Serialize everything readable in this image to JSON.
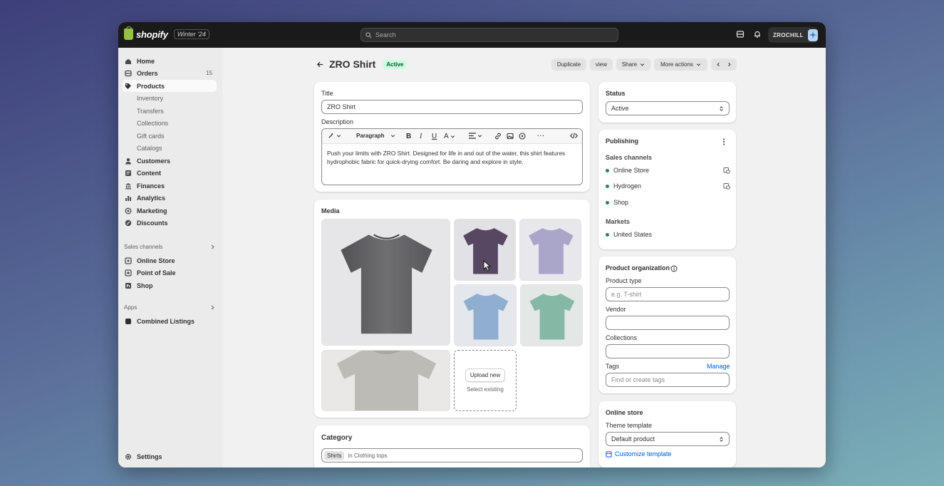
{
  "topbar": {
    "logo_text": "shopify",
    "edition": "Winter '24",
    "search_placeholder": "Search",
    "store_name": "ZROCHILL"
  },
  "sidebar": {
    "items": [
      {
        "label": "Home"
      },
      {
        "label": "Orders",
        "count": "15"
      },
      {
        "label": "Products"
      },
      {
        "label": "Inventory"
      },
      {
        "label": "Transfers"
      },
      {
        "label": "Collections"
      },
      {
        "label": "Gift cards"
      },
      {
        "label": "Catalogs"
      },
      {
        "label": "Customers"
      },
      {
        "label": "Content"
      },
      {
        "label": "Finances"
      },
      {
        "label": "Analytics"
      },
      {
        "label": "Marketing"
      },
      {
        "label": "Discounts"
      }
    ],
    "sales_channels_heading": "Sales channels",
    "sales_channels": [
      {
        "label": "Online Store"
      },
      {
        "label": "Point of Sale"
      },
      {
        "label": "Shop"
      }
    ],
    "apps_heading": "Apps",
    "apps": [
      {
        "label": "Combined Listings"
      }
    ],
    "settings_label": "Settings"
  },
  "header": {
    "title": "ZRO Shirt",
    "status_badge": "Active",
    "actions": {
      "duplicate": "Duplicate",
      "view": "view",
      "share": "Share",
      "more": "More actions"
    }
  },
  "product": {
    "title_label": "Title",
    "title_value": "ZRO Shirt",
    "description_label": "Description",
    "paragraph_label": "Paragraph",
    "description_text": "Push your limits with ZRO Shirt. Designed for life in and out of the water, this shirt features hydrophobic fabric for quick-drying comfort. Be daring and explore in style."
  },
  "media": {
    "heading": "Media",
    "upload_label": "Upload new",
    "select_label": "Select existing",
    "shirt_colors": [
      "#6f6f72",
      "#574763",
      "#a9a6c9",
      "#8faed0",
      "#86b8a6",
      "#bdbbb6"
    ]
  },
  "category": {
    "heading": "Category",
    "chip": "Shirts",
    "path": "in Clothing tops"
  },
  "status_card": {
    "heading": "Status",
    "value": "Active"
  },
  "publishing": {
    "heading": "Publishing",
    "sales_channels_label": "Sales channels",
    "channels": [
      "Online Store",
      "Hydrogen",
      "Shop"
    ],
    "markets_label": "Markets",
    "markets": [
      "United States"
    ]
  },
  "organization": {
    "heading": "Product organization",
    "type_label": "Product type",
    "type_placeholder": "e.g. T-shirt",
    "vendor_label": "Vendor",
    "collections_label": "Collections",
    "tags_label": "Tags",
    "tags_manage": "Manage",
    "tags_placeholder": "Find or create tags"
  },
  "online_store": {
    "heading": "Online store",
    "theme_label": "Theme template",
    "theme_value": "Default product",
    "customize_label": "Customize template"
  },
  "colors": {
    "accent": "#005bd3",
    "status_green": "#29845a"
  }
}
